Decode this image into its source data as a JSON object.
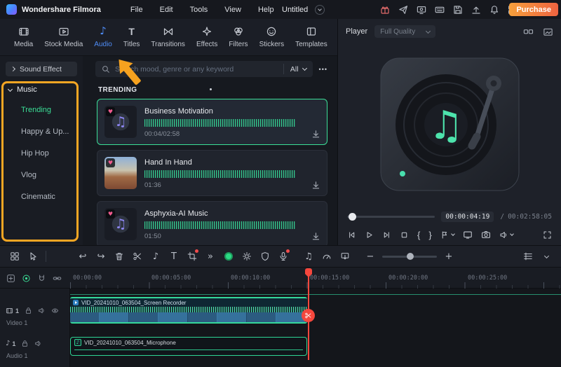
{
  "colors": {
    "accent_blue": "#4f8df7",
    "accent_green": "#3bdf97",
    "accent_orange": "#f5a623",
    "playhead_red": "#f5473d",
    "purchase_gradient": [
      "#f7a03c",
      "#ee6340"
    ]
  },
  "glyphs": {
    "note": "♪",
    "beamed_note": "♫",
    "text_tool": "T",
    "double_chevron": "»",
    "undo": "↩",
    "redo": "↪",
    "brace_open": "{",
    "brace_close": "}",
    "zoom_out": "−",
    "zoom_in": "+",
    "more": "•••",
    "heart": "♥"
  },
  "menubar": {
    "app_name": "Wondershare Filmora",
    "menus": [
      "File",
      "Edit",
      "Tools",
      "View",
      "Help"
    ],
    "project_name": "Untitled",
    "purchase_label": "Purchase"
  },
  "tabs": [
    {
      "label": "Media"
    },
    {
      "label": "Stock Media"
    },
    {
      "label": "Audio",
      "active": true
    },
    {
      "label": "Titles"
    },
    {
      "label": "Transitions"
    },
    {
      "label": "Effects"
    },
    {
      "label": "Filters"
    },
    {
      "label": "Stickers"
    },
    {
      "label": "Templates"
    }
  ],
  "sidebar": {
    "sound_effect_label": "Sound Effect",
    "music_group_label": "Music",
    "items": [
      {
        "label": "Trending",
        "selected": true
      },
      {
        "label": "Happy & Up..."
      },
      {
        "label": "Hip Hop"
      },
      {
        "label": "Vlog"
      },
      {
        "label": "Cinematic"
      }
    ]
  },
  "search": {
    "placeholder": "Search mood, genre or any keyword",
    "filter_label": "All"
  },
  "music_panel": {
    "section_title": "TRENDING",
    "items": [
      {
        "title": "Business Motivation",
        "duration": "00:04/02:58",
        "selected": true
      },
      {
        "title": "Hand In Hand",
        "duration": "01:36"
      },
      {
        "title": "Asphyxia-AI Music",
        "duration": "01:50"
      }
    ]
  },
  "player": {
    "title": "Player",
    "quality_label": "Full Quality",
    "current_time": "00:00:04:19",
    "time_separator": "/",
    "total_time": "00:02:58:05"
  },
  "timeline": {
    "ruler_labels": [
      "00:00:00",
      "00:00:05:00",
      "00:00:10:00",
      "00:00:15:00",
      "00:00:20:00",
      "00:00:25:00"
    ],
    "tracks": [
      {
        "number": "1",
        "name": "Video 1",
        "clip_label": "VID_20241010_063504_Screen Recorder"
      },
      {
        "number": "1",
        "name": "Audio 1",
        "clip_label": "VID_20241010_063504_Microphone"
      }
    ]
  }
}
